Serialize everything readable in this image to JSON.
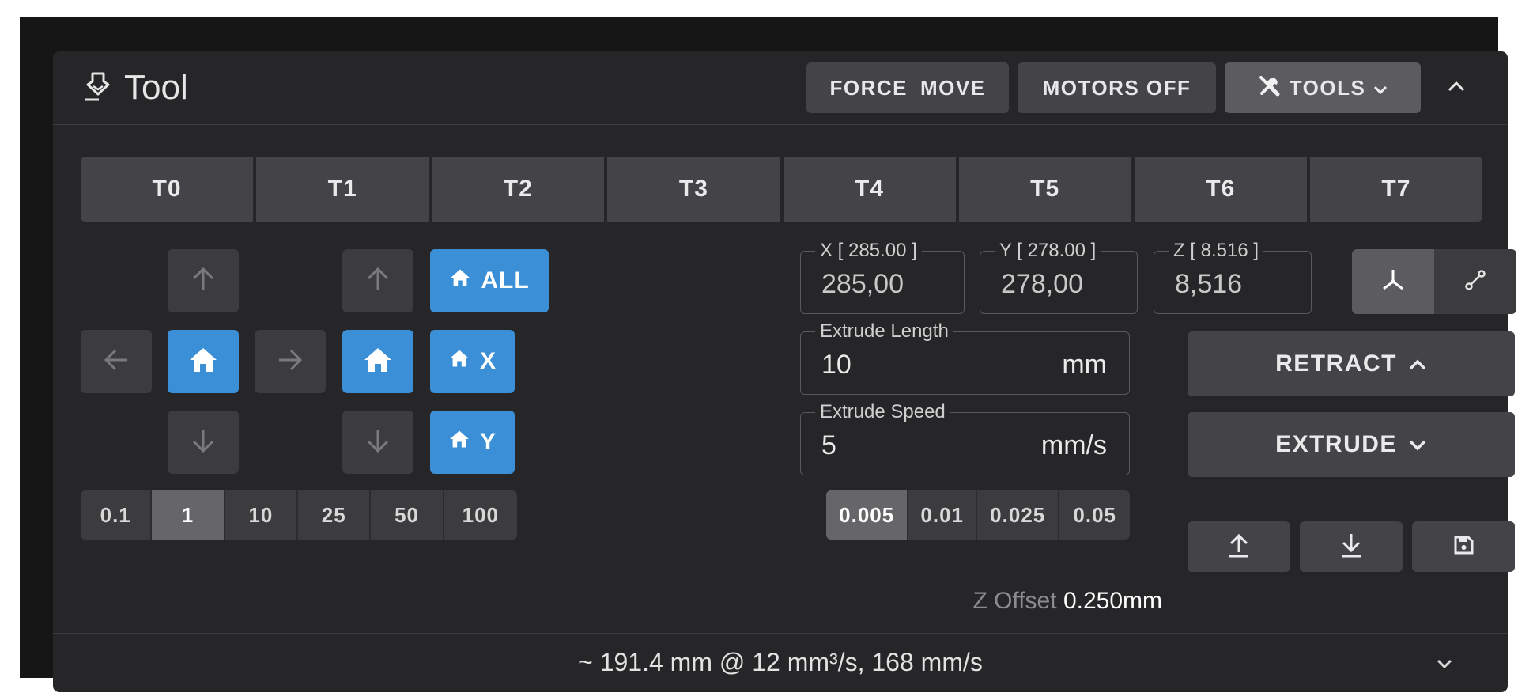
{
  "header": {
    "title": "Tool",
    "force_move_label": "FORCE_MOVE",
    "motors_off_label": "MOTORS OFF",
    "tools_label": "TOOLS",
    "icons": {
      "title": "tool-nozzle-icon",
      "tools": "wrench-screwdriver-icon",
      "tools_dropdown": "chevron-down-icon",
      "collapse": "chevron-up-icon"
    }
  },
  "tools": [
    "T0",
    "T1",
    "T2",
    "T3",
    "T4",
    "T5",
    "T6",
    "T7"
  ],
  "jog": {
    "home_all_label": "ALL",
    "home_x_label": "X",
    "home_y_label": "Y",
    "distances": [
      "0.1",
      "1",
      "10",
      "25",
      "50",
      "100"
    ],
    "active_distance": "1"
  },
  "position": {
    "x": {
      "label": "X [ 285.00 ]",
      "value": "285,00"
    },
    "y": {
      "label": "Y [ 278.00 ]",
      "value": "278,00"
    },
    "z": {
      "label": "Z [ 8.516 ]",
      "value": "8,516"
    }
  },
  "move_mode": {
    "options": [
      "axes-mode-icon",
      "diagonal-move-icon"
    ],
    "active": "axes-mode-icon"
  },
  "extrude": {
    "length_label": "Extrude Length",
    "length_value": "10",
    "length_unit": "mm",
    "speed_label": "Extrude Speed",
    "speed_value": "5",
    "speed_unit": "mm/s",
    "retract_label": "RETRACT",
    "extrude_label": "EXTRUDE"
  },
  "z_adjust": {
    "steps": [
      "0.005",
      "0.01",
      "0.025",
      "0.05"
    ],
    "active_step": "0.005",
    "offset_label": "Z Offset",
    "offset_value": "0.250mm"
  },
  "z_offset_buttons": [
    "arrow-up-to-bar-icon",
    "arrow-down-to-bar-icon",
    "save-icon"
  ],
  "footer": {
    "text": "~ 191.4 mm @ 12 mm³/s, 168 mm/s"
  },
  "colors": {
    "accent": "#3b8fd6",
    "card": "#262628",
    "button": "#444448",
    "jog": "#3c3c3f"
  }
}
